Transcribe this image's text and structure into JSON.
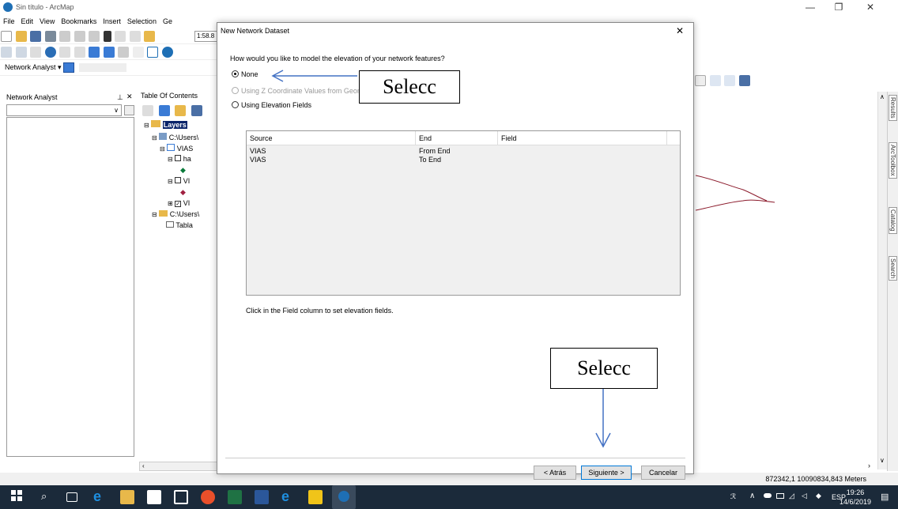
{
  "app": {
    "title": "Sin título - ArcMap",
    "menus": [
      "File",
      "Edit",
      "View",
      "Bookmarks",
      "Insert",
      "Selection",
      "Ge"
    ],
    "scale": "1:58.8",
    "network_analyst_toolbar": "Network Analyst ▾"
  },
  "panels": {
    "network_analyst": {
      "title": "Network Analyst",
      "pin": "⬍",
      "close": "✕"
    },
    "toc": {
      "title": "Table Of Contents",
      "rows": [
        {
          "label": "Layers",
          "indent": 0
        },
        {
          "label": "C:\\Users\\",
          "indent": 1
        },
        {
          "label": "VIAS",
          "indent": 2
        },
        {
          "label": "ha",
          "indent": 3
        },
        {
          "label": "VI",
          "indent": 3
        },
        {
          "label": "VI",
          "indent": 3
        },
        {
          "label": "C:\\Users\\",
          "indent": 1
        },
        {
          "label": "Tabla",
          "indent": 2
        }
      ]
    }
  },
  "dock_tabs": [
    "Results",
    "ArcToolbox",
    "Catalog",
    "Search"
  ],
  "status": {
    "coords": "872342,1  10090834,843 Meters"
  },
  "dialog": {
    "title": "New Network Dataset",
    "question": "How would you like to model the elevation of your network features?",
    "options": {
      "none": "None",
      "z_coords": "Using Z Coordinate Values from Geom",
      "elevation_fields": "Using Elevation Fields"
    },
    "grid": {
      "headers": {
        "source": "Source",
        "end": "End",
        "field": "Field"
      },
      "rows": [
        {
          "source": "VIAS",
          "end": "From End",
          "field": ""
        },
        {
          "source": "VIAS",
          "end": "To End",
          "field": ""
        }
      ]
    },
    "hint": "Click in the Field column to set elevation fields.",
    "buttons": {
      "back": "< Atrás",
      "next": "Siguiente >",
      "cancel": "Cancelar"
    }
  },
  "annotations": {
    "callout_top": "Selecc",
    "callout_bottom": "Selecc",
    "arrow_color": "#4472c4"
  },
  "taskbar": {
    "language": "ESP",
    "time": "19:26",
    "date": "14/6/2019"
  }
}
